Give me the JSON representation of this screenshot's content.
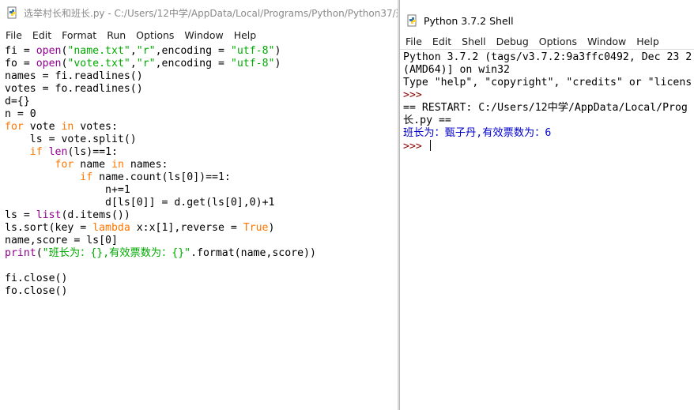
{
  "editor": {
    "title": "选举村长和班长.py - C:/Users/12中学/AppData/Local/Programs/Python/Python37/选",
    "menu": [
      "File",
      "Edit",
      "Format",
      "Run",
      "Options",
      "Window",
      "Help"
    ],
    "code_lines": [
      "fi = open(\"name.txt\",\"r\",encoding = \"utf-8\")",
      "fo = open(\"vote.txt\",\"r\",encoding = \"utf-8\")",
      "names = fi.readlines()",
      "votes = fo.readlines()",
      "d={}",
      "n = 0",
      "for vote in votes:",
      "    ls = vote.split()",
      "    if len(ls)==1:",
      "        for name in names:",
      "            if name.count(ls[0])==1:",
      "                n+=1",
      "                d[ls[0]] = d.get(ls[0],0)+1",
      "ls = list(d.items())",
      "ls.sort(key = lambda x:x[1],reverse = True)",
      "name,score = ls[0]",
      "print(\"班长为：{},有效票数为：{}\".format(name,score))",
      "",
      "fi.close()",
      "fo.close()"
    ]
  },
  "shell": {
    "title": "Python 3.7.2 Shell",
    "menu": [
      "File",
      "Edit",
      "Shell",
      "Debug",
      "Options",
      "Window",
      "Help"
    ],
    "lines": [
      {
        "text": "Python 3.7.2 (tags/v3.7.2:9a3ffc0492, Dec 23 2",
        "kind": "plain"
      },
      {
        "text": "(AMD64)] on win32",
        "kind": "plain"
      },
      {
        "text": "Type \"help\", \"copyright\", \"credits\" or \"licens",
        "kind": "plain"
      },
      {
        "text": ">>>",
        "kind": "prompt"
      },
      {
        "text": "== RESTART: C:/Users/12中学/AppData/Local/Prog",
        "kind": "plain"
      },
      {
        "text": "长.py ==",
        "kind": "plain"
      },
      {
        "text": "班长为：甄子丹,有效票数为：6",
        "kind": "out"
      },
      {
        "text": ">>> ",
        "kind": "prompt_cursor"
      }
    ]
  }
}
